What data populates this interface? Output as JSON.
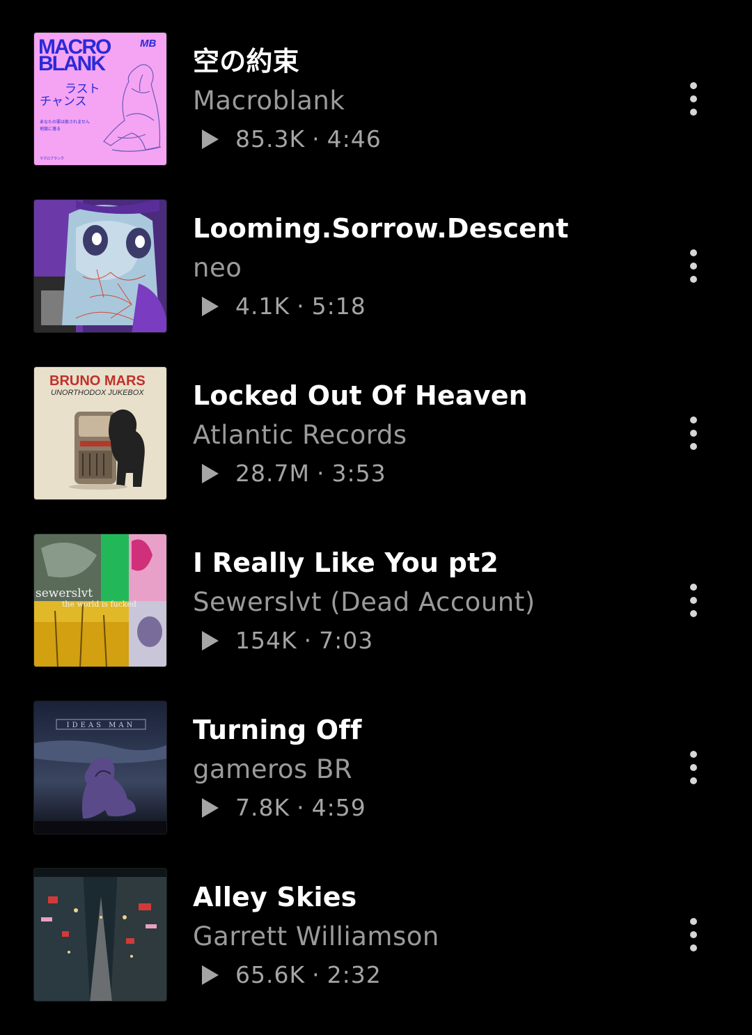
{
  "tracks": [
    {
      "title": "空の約束",
      "artist": "Macroblank",
      "plays": "85.3K",
      "separator": "·",
      "duration": "4:46",
      "artwork_text": {
        "line1": "MACRO",
        "line2": "BLANK",
        "badge": "MB",
        "jp1": "ラスト",
        "jp2": "チャンス",
        "small1": "あなたの罪は赦されません",
        "small2": "地獄に落る",
        "footer": "マクロブランク"
      }
    },
    {
      "title": "Looming.Sorrow.Descent",
      "artist": "neo",
      "plays": "4.1K",
      "separator": "·",
      "duration": "5:18"
    },
    {
      "title": "Locked Out Of Heaven",
      "artist": "Atlantic Records",
      "plays": "28.7M",
      "separator": "·",
      "duration": "3:53",
      "artwork_text": {
        "line1": "BRUNO MARS",
        "line2": "UNORTHODOX JUKEBOX"
      }
    },
    {
      "title": "I Really Like You pt2",
      "artist": "Sewerslvt (Dead Account)",
      "plays": "154K",
      "separator": "·",
      "duration": "7:03",
      "artwork_text": {
        "line1": "sewerslvt",
        "line2": "the world is fucked"
      }
    },
    {
      "title": "Turning Off",
      "artist": "gameros BR",
      "plays": "7.8K",
      "separator": "·",
      "duration": "4:59",
      "artwork_text": {
        "line1": "IDEAS MAN"
      }
    },
    {
      "title": "Alley Skies",
      "artist": "Garrett Williamson",
      "plays": "65.6K",
      "separator": "·",
      "duration": "2:32"
    }
  ],
  "colors": {
    "background": "#000000",
    "title": "#ffffff",
    "secondary": "#9b9b9b",
    "menu_dots": "#d6d6d6"
  },
  "icons": {
    "play": "play-icon",
    "more": "more-options-icon"
  }
}
